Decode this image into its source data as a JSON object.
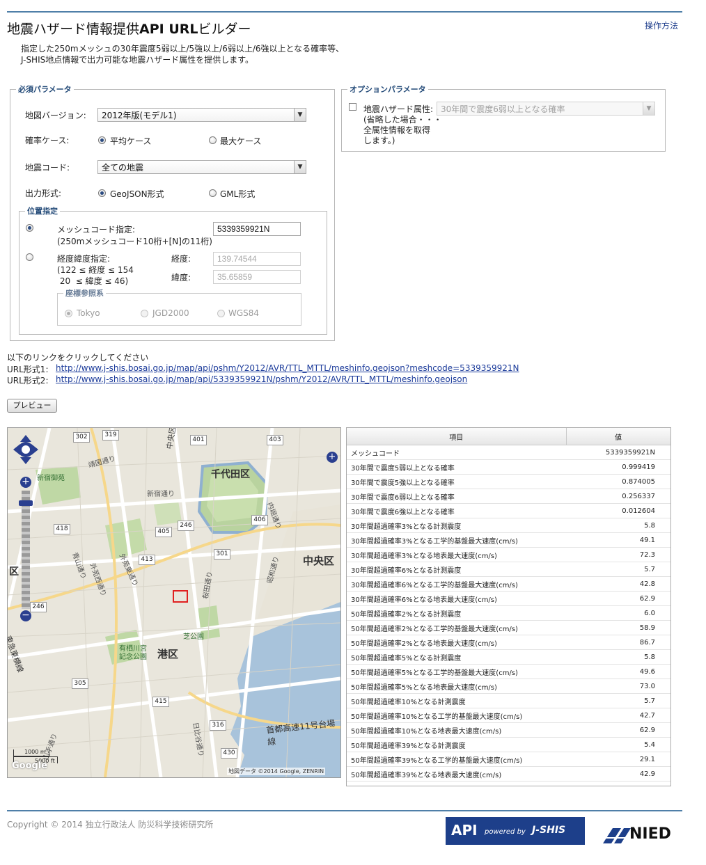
{
  "header": {
    "title_prefix": "地震ハザード情報提供",
    "title_bold": "API URL",
    "title_suffix": "ビルダー",
    "help_link": "操作方法"
  },
  "description": {
    "line1": "指定した250mメッシュの30年震度5弱以上/5強以上/6弱以上/6強以上となる確率等、",
    "line2": "J-SHIS地点情報で出力可能な地震ハザード属性を提供します。"
  },
  "required": {
    "legend": "必須パラメータ",
    "map_version_label": "地図バージョン:",
    "map_version_value": "2012年版(モデル1)",
    "prob_case_label": "確率ケース:",
    "prob_case_avg": "平均ケース",
    "prob_case_max": "最大ケース",
    "quake_code_label": "地震コード:",
    "quake_code_value": "全ての地震",
    "format_label": "出力形式:",
    "format_geojson": "GeoJSON形式",
    "format_gml": "GML形式"
  },
  "position": {
    "legend": "位置指定",
    "mesh_label": "メッシュコード指定:",
    "mesh_hint": "(250mメッシュコード10桁+[N]の11桁)",
    "mesh_value": "5339359921N",
    "latlon_label": "経度緯度指定:",
    "lon_range": "(122 ≤ 経度 ≤ 154",
    "lat_range": " 20  ≤ 緯度 ≤ 46)",
    "lon_label": "経度:",
    "lon_value": "139.74544",
    "lat_label": "緯度:",
    "lat_value": "35.65859",
    "crs_legend": "座標参照系",
    "crs_tokyo": "Tokyo",
    "crs_jgd": "JGD2000",
    "crs_wgs": "WGS84"
  },
  "optional": {
    "legend": "オプションパラメータ",
    "attr_label": "地震ハザード属性:",
    "attr_note1": "(省略した場合・・・",
    "attr_note2": "全属性情報を取得",
    "attr_note3": "します。)",
    "attr_value": "30年間で震度6弱以上となる確率"
  },
  "links": {
    "intro": "以下のリンクをクリックしてください",
    "label1": "URL形式1:",
    "url1": "http://www.j-shis.bosai.go.jp/map/api/pshm/Y2012/AVR/TTL_MTTL/meshinfo.geojson?meshcode=5339359921N",
    "label2": "URL形式2:",
    "url2": "http://www.j-shis.bosai.go.jp/map/api/5339359921N/pshm/Y2012/AVR/TTL_MTTL/meshinfo.geojson"
  },
  "preview_button": "プレビュー",
  "map": {
    "labels": {
      "chiyoda": "千代田区",
      "chuo_right": "中央区",
      "chuo_top": "中央区",
      "minato": "港区",
      "shinjuku_gyoen": "新宿御苑",
      "arisugawa1": "有栖川宮",
      "arisugawa2": "記念公園",
      "shiba": "芝公園",
      "ku_left": "区",
      "shinjuku_dori": "新宿通り",
      "yasukuni_dori": "靖国通り",
      "uchibori": "内堀通り",
      "aoyama": "青山通り",
      "gaien": "外苑西通り",
      "gaienhigashi": "外苑東通り",
      "sakurada": "桜田通り",
      "hibiya": "日比谷通り",
      "showa": "昭和通り",
      "shuto": "首都高速11号台場線",
      "tomei": "東急東横線",
      "yamate": "山手通り",
      "scale1": "1000 m",
      "scale2": "5000 ft",
      "copyright": "地図データ ©2014 Google, ZENRIN",
      "google": "Google"
    },
    "route_numbers": [
      "302",
      "319",
      "401",
      "403",
      "418",
      "405",
      "246",
      "406",
      "413",
      "301",
      "246",
      "305",
      "415",
      "316",
      "430"
    ]
  },
  "result_table": {
    "headers": [
      "項目",
      "値"
    ],
    "rows": [
      [
        "メッシュコード",
        "5339359921N"
      ],
      [
        "30年間で震度5弱以上となる確率",
        "0.999419"
      ],
      [
        "30年間で震度5強以上となる確率",
        "0.874005"
      ],
      [
        "30年間で震度6弱以上となる確率",
        "0.256337"
      ],
      [
        "30年間で震度6強以上となる確率",
        "0.012604"
      ],
      [
        "30年間超過確率3%となる計測震度",
        "5.8"
      ],
      [
        "30年間超過確率3%となる工学的基盤最大速度(cm/s)",
        "49.1"
      ],
      [
        "30年間超過確率3%となる地表最大速度(cm/s)",
        "72.3"
      ],
      [
        "30年間超過確率6%となる計測震度",
        "5.7"
      ],
      [
        "30年間超過確率6%となる工学的基盤最大速度(cm/s)",
        "42.8"
      ],
      [
        "30年間超過確率6%となる地表最大速度(cm/s)",
        "62.9"
      ],
      [
        "50年間超過確率2%となる計測震度",
        "6.0"
      ],
      [
        "50年間超過確率2%となる工学的基盤最大速度(cm/s)",
        "58.9"
      ],
      [
        "50年間超過確率2%となる地表最大速度(cm/s)",
        "86.7"
      ],
      [
        "50年間超過確率5%となる計測震度",
        "5.8"
      ],
      [
        "50年間超過確率5%となる工学的基盤最大速度(cm/s)",
        "49.6"
      ],
      [
        "50年間超過確率5%となる地表最大速度(cm/s)",
        "73.0"
      ],
      [
        "50年間超過確率10%となる計測震度",
        "5.7"
      ],
      [
        "50年間超過確率10%となる工学的基盤最大速度(cm/s)",
        "42.7"
      ],
      [
        "50年間超過確率10%となる地表最大速度(cm/s)",
        "62.9"
      ],
      [
        "50年間超過確率39%となる計測震度",
        "5.4"
      ],
      [
        "50年間超過確率39%となる工学的基盤最大速度(cm/s)",
        "29.1"
      ],
      [
        "50年間超過確率39%となる地表最大速度(cm/s)",
        "42.9"
      ]
    ]
  },
  "footer": {
    "copyright": "Copyright © 2014 独立行政法人 防災科学技術研究所",
    "api_logo_main": "API",
    "api_logo_powered": "powered by",
    "api_logo_brand": "J-SHIS",
    "nied_logo": "NIED"
  },
  "colors": {
    "accent_line": "#4f7fa8",
    "link": "#1a3a9a",
    "legend_text": "#234a78",
    "map_nav": "#2a3f8f",
    "marker": "#e02020",
    "api_logo_bg": "#1d3f8a"
  }
}
